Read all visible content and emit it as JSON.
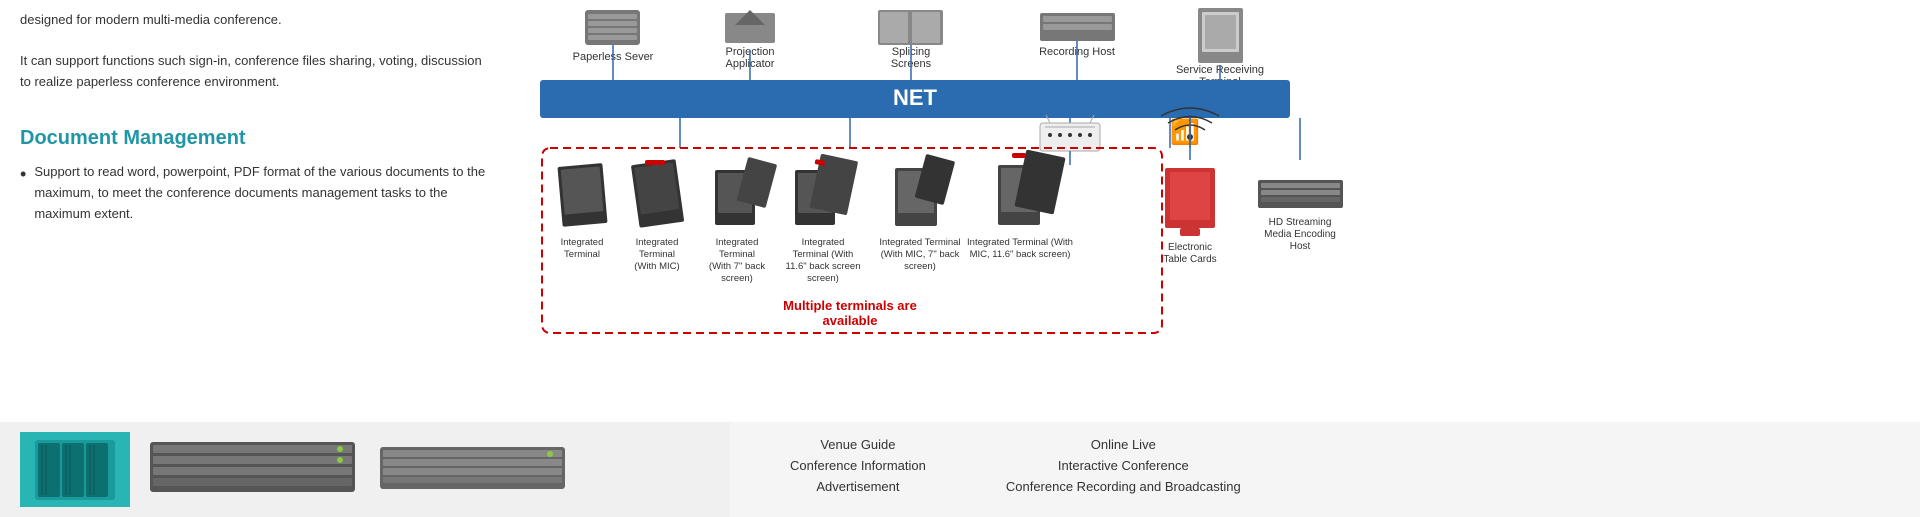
{
  "left": {
    "intro_text": "designed for modern multi-media conference.",
    "intro_text2": "It can support functions such sign-in, conference files sharing, voting, discussion to realize paperless conference environment.",
    "doc_title": "Document Management",
    "bullet_text": "Support to read word, powerpoint, PDF format of the various documents to the maximum, to meet the conference documents management tasks to the maximum extent."
  },
  "diagram": {
    "net_label": "NET",
    "top_devices": [
      {
        "label": "Paperless Sever"
      },
      {
        "label": "Projection\nApplicator"
      },
      {
        "label": "Splicing\nScreens"
      },
      {
        "label": "Recording Host"
      },
      {
        "label": "Service Receiving\nTerminal"
      }
    ],
    "terminal_box_devices": [
      {
        "label": "Integrated\nTerminal"
      },
      {
        "label": "Integrated\nTerminal\n(With MIC)"
      },
      {
        "label": "Integrated\nTerminal\n(With 7\" back\nscreen)"
      },
      {
        "label": "Integrated\nTerminal\n(With\n11.6\" back screen\nscreen)"
      },
      {
        "label": "Integrated Terminal\n(With MIC, 7\" back\nscreen)"
      },
      {
        "label": "Integrated Terminal (With\nMIC, 11.6\" back screen)"
      }
    ],
    "multiple_terminals_line1": "Multiple terminals are",
    "multiple_terminals_line2": "available",
    "right_devices": [
      {
        "label": "Electronic\nTable Cards"
      },
      {
        "label": "HD Streaming\nMedia Encoding\nHost"
      }
    ]
  },
  "bottom": {
    "left_links": [
      "Venue Guide",
      "Conference Information",
      "Advertisement"
    ],
    "right_links": [
      "Online Live",
      "Interactive Conference",
      "Conference Recording and Broadcasting"
    ]
  }
}
